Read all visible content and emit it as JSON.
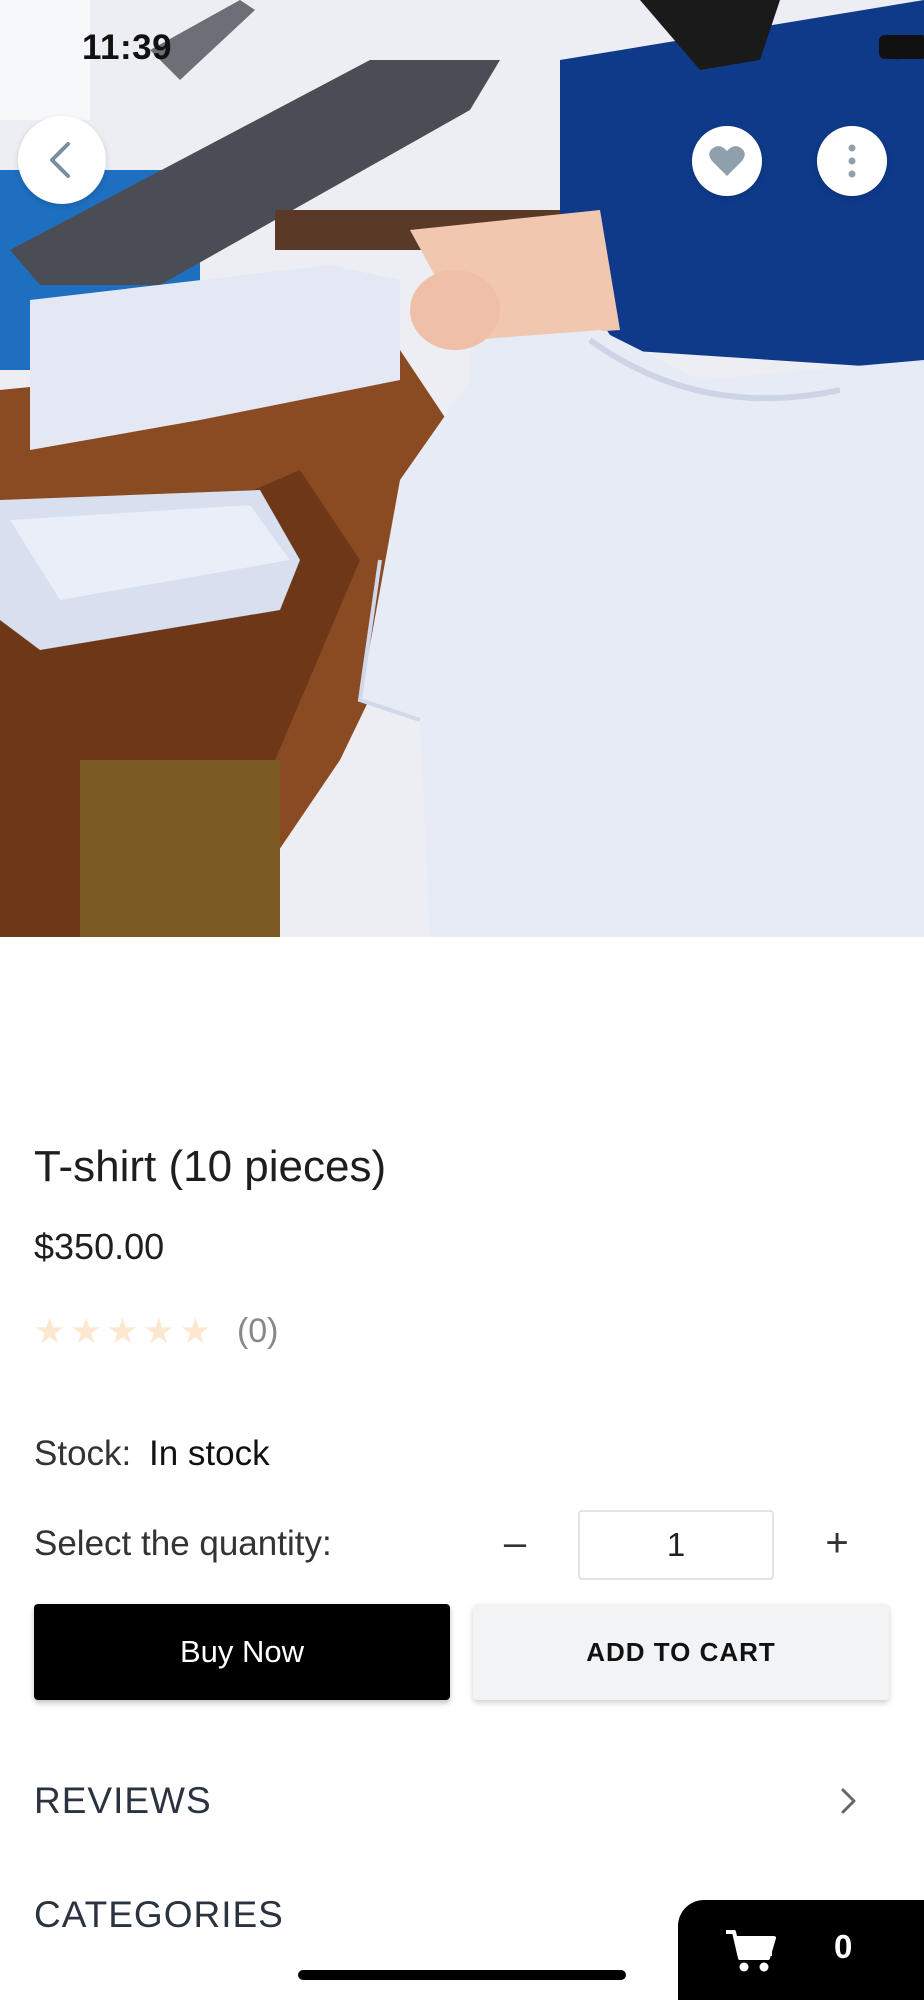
{
  "status_bar": {
    "time": "11:39"
  },
  "hero": {
    "image_icon": "product-photo"
  },
  "top_actions": {
    "back_icon": "chevron-left-icon",
    "favorite_icon": "heart-icon",
    "more_icon": "more-vertical-icon"
  },
  "product": {
    "title": "T-shirt (10 pieces)",
    "price": "$350.00",
    "rating": {
      "stars": 0,
      "max_stars": 5,
      "count_label": "(0)"
    },
    "stock_label": "Stock:",
    "stock_value": "In stock",
    "quantity_label": "Select the quantity:",
    "quantity_value": "1",
    "minus_symbol": "–",
    "plus_symbol": "+"
  },
  "actions": {
    "buy_now": "Buy Now",
    "add_to_cart": "ADD TO CART"
  },
  "sections": {
    "reviews": "REVIEWS",
    "categories": "CATEGORIES"
  },
  "floating_cart": {
    "count": "0"
  },
  "colors": {
    "accent": "#000000",
    "star_empty": "#fde8cf",
    "secondary_button": "#f2f3f5"
  }
}
